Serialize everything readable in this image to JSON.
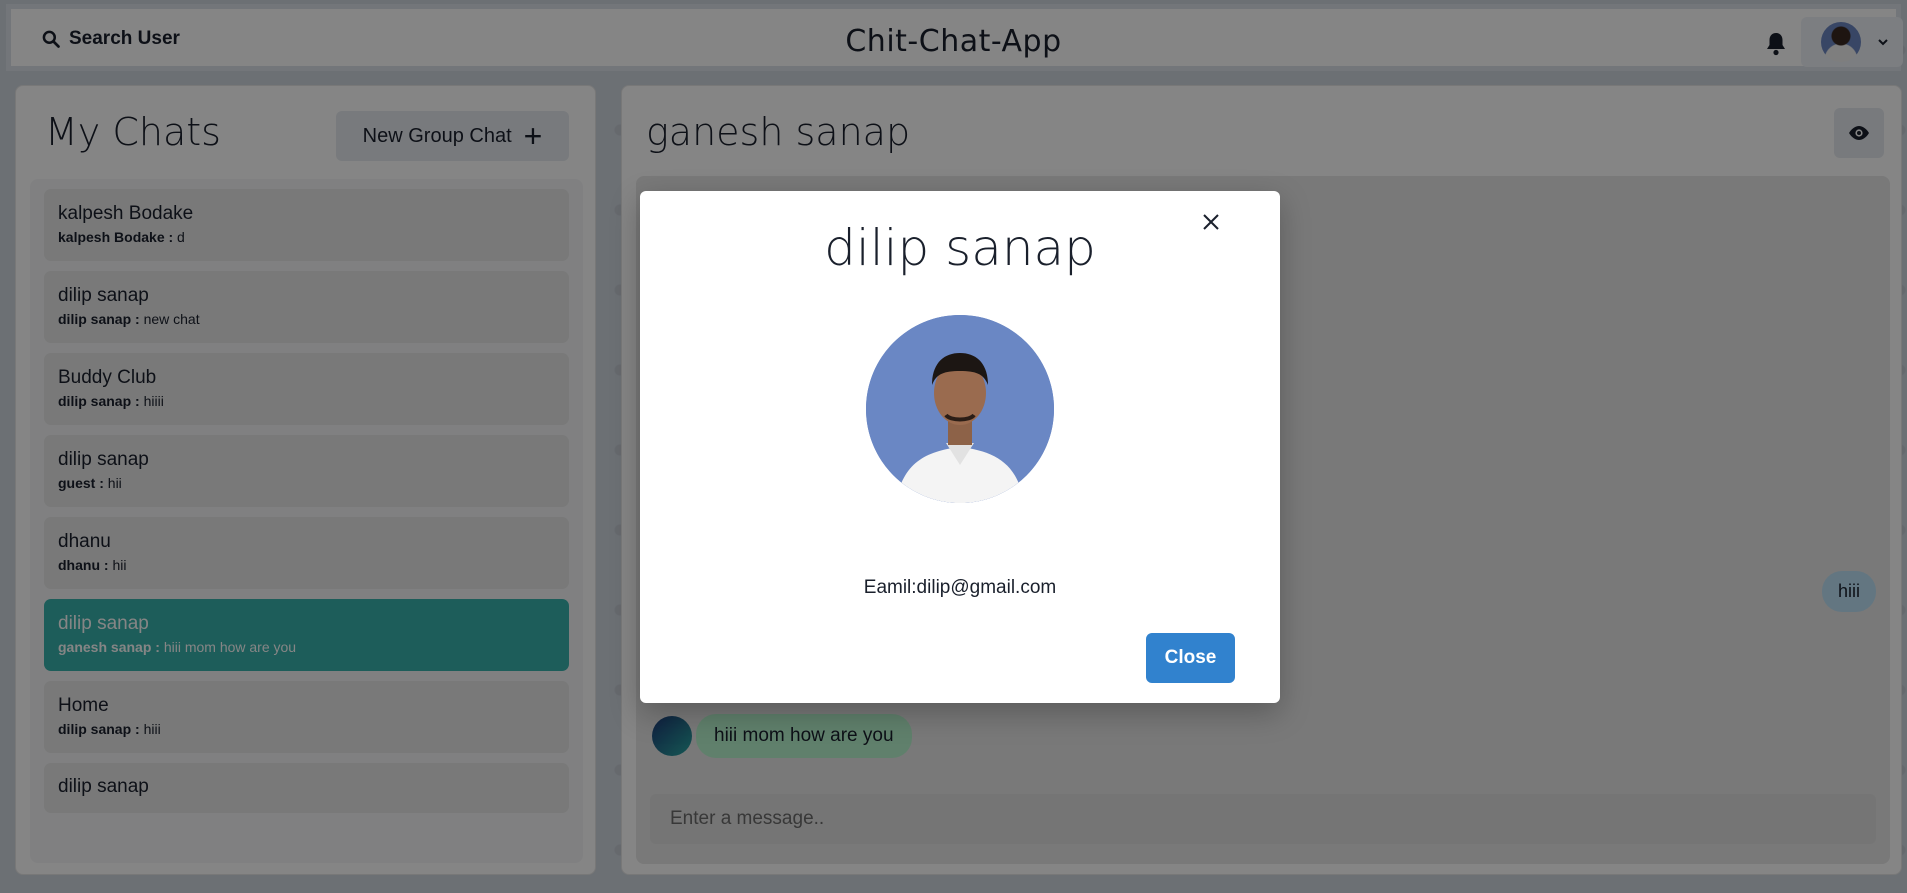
{
  "header": {
    "search_label": "Search User",
    "app_title": "Chit-Chat-App"
  },
  "left_panel": {
    "title": "My Chats",
    "new_group_label": "New Group Chat",
    "chats": [
      {
        "name": "kalpesh Bodake",
        "sender": "kalpesh Bodake :",
        "message": "d"
      },
      {
        "name": "dilip sanap",
        "sender": "dilip sanap :",
        "message": "new chat"
      },
      {
        "name": "Buddy Club",
        "sender": "dilip sanap :",
        "message": "hiiii"
      },
      {
        "name": "dilip sanap",
        "sender": "guest :",
        "message": "hii"
      },
      {
        "name": "dhanu",
        "sender": "dhanu :",
        "message": "hii"
      },
      {
        "name": "dilip sanap",
        "sender": "ganesh sanap :",
        "message": "hiii mom how are you"
      },
      {
        "name": "Home",
        "sender": "dilip sanap :",
        "message": "hiii"
      },
      {
        "name": "dilip sanap"
      }
    ]
  },
  "chat": {
    "title": "ganesh sanap",
    "messages": [
      {
        "side": "right",
        "text": "hiii"
      },
      {
        "side": "left",
        "text": "hiii mom how are you"
      }
    ],
    "input_placeholder": "Enter a message.."
  },
  "modal": {
    "title": "dilip sanap",
    "email": "Eamil:dilip@gmail.com",
    "close_label": "Close"
  },
  "colors": {
    "active_chat": "#38b2ac",
    "close_button": "#3182ce",
    "bubble_sent": "#bee3f8",
    "bubble_received": "#b9f5d0"
  }
}
